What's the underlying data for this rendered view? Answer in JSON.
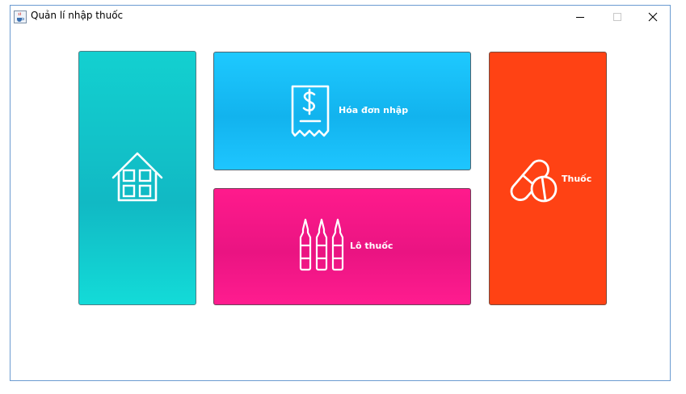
{
  "window": {
    "title": "Quản lí nhập thuốc",
    "icon": "java-cup-icon"
  },
  "titlebar_buttons": {
    "minimize": "minimize-icon",
    "maximize": "maximize-icon",
    "close": "close-icon"
  },
  "tiles": {
    "home": {
      "label": "",
      "icon": "house-icon",
      "color": "#13d0d0"
    },
    "invoice": {
      "label": "Hóa đơn nhập",
      "icon": "receipt-dollar-icon",
      "color": "#1ec9ff"
    },
    "batch": {
      "label": "Lô thuốc",
      "icon": "ampoules-icon",
      "color": "#ff1a8c"
    },
    "medicine": {
      "label": "Thuốc",
      "icon": "pills-icon",
      "color": "#ff4214"
    }
  }
}
